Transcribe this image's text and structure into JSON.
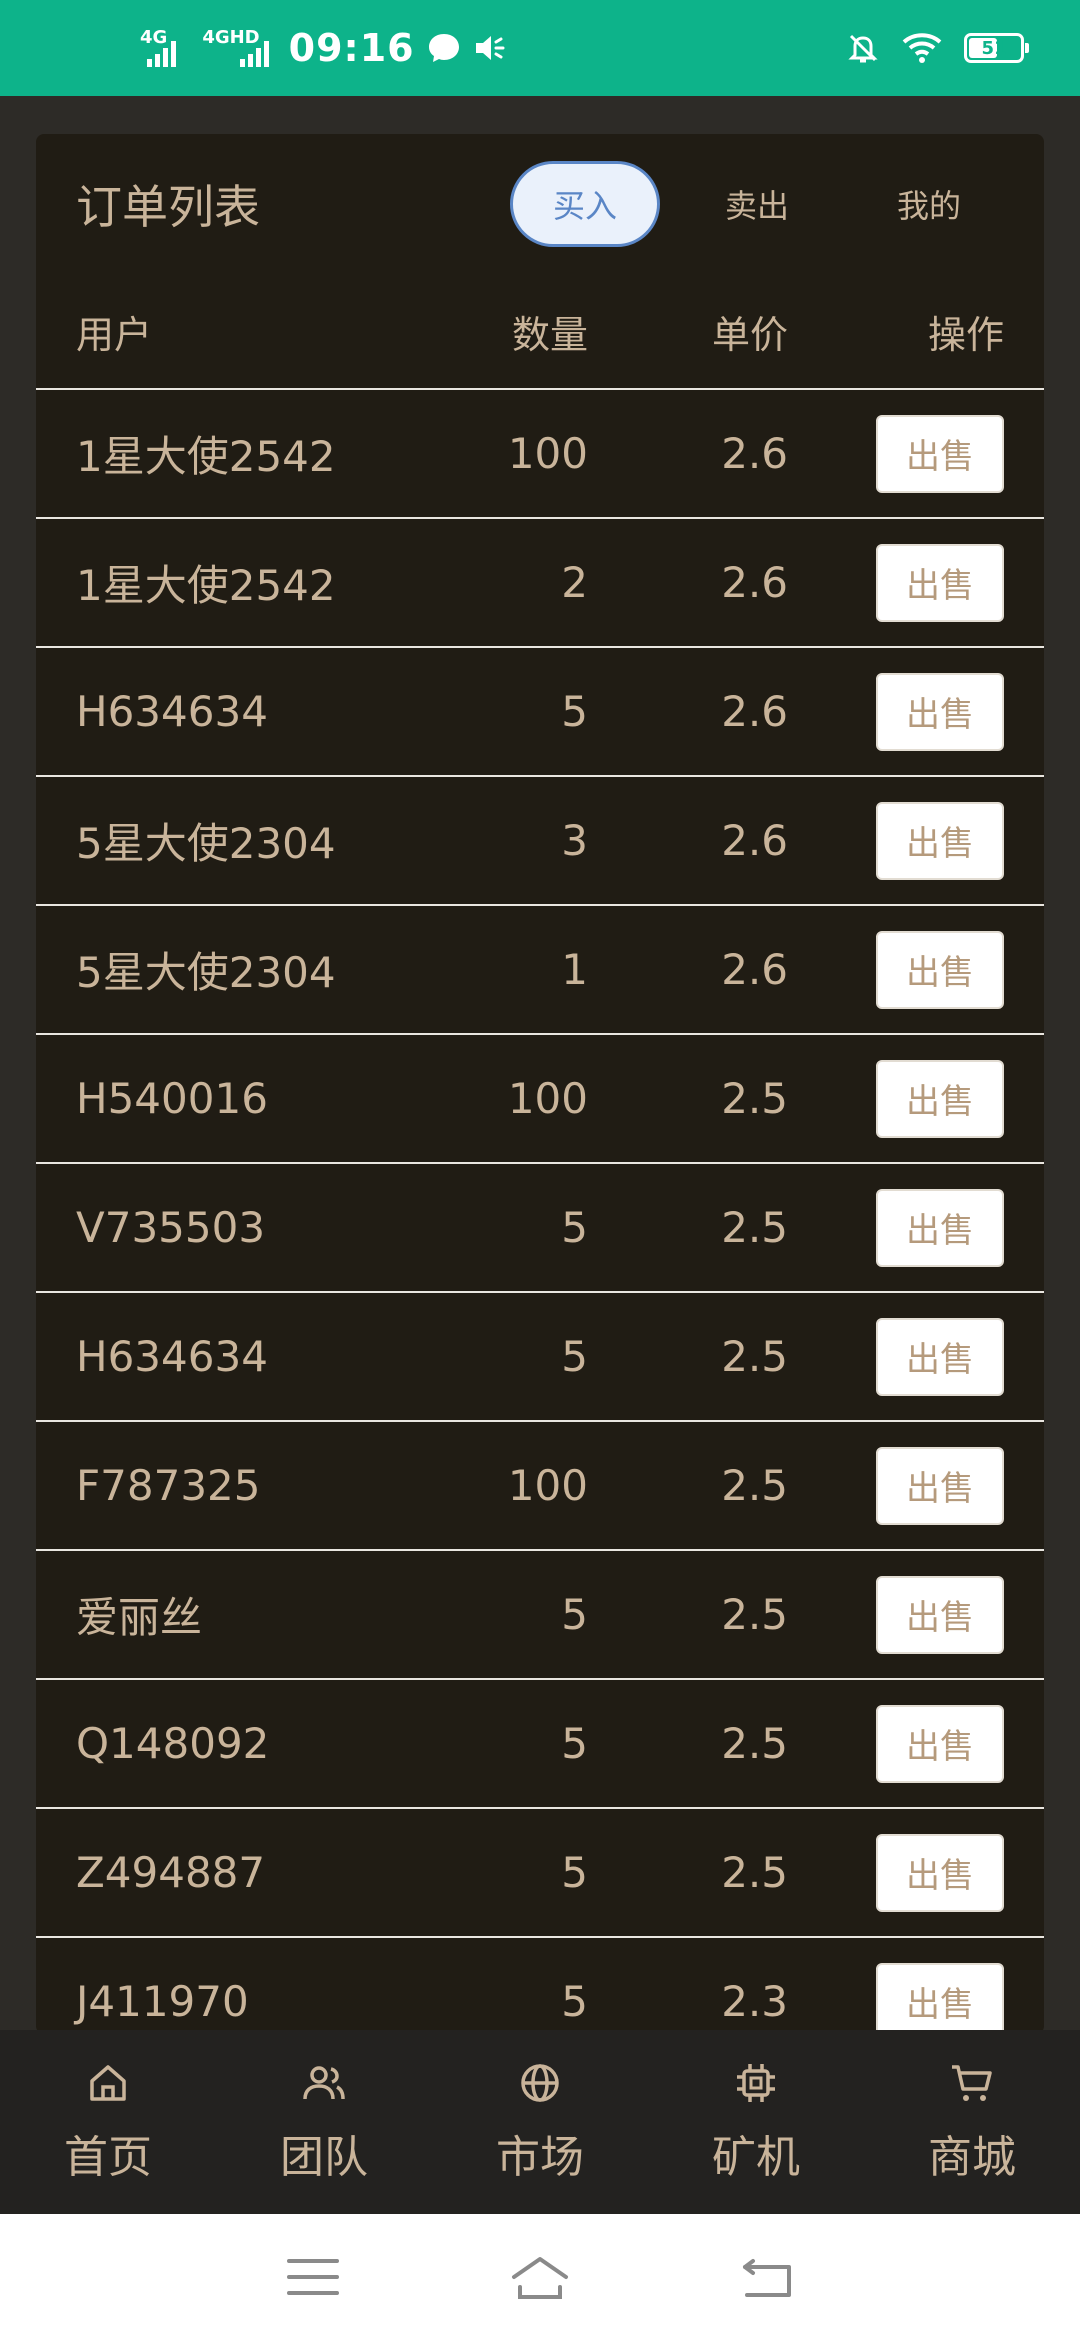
{
  "status_bar": {
    "net1": "4G",
    "net2": "4GHD",
    "time": "09:16",
    "battery": "51"
  },
  "header": {
    "title": "订单列表",
    "tabs": [
      {
        "label": "买入",
        "active": true
      },
      {
        "label": "卖出",
        "active": false
      },
      {
        "label": "我的",
        "active": false
      }
    ]
  },
  "table": {
    "columns": [
      "用户",
      "数量",
      "单价",
      "操作"
    ],
    "rows": [
      {
        "user": "1星大使2542",
        "qty": "100",
        "price": "2.6",
        "action": "出售"
      },
      {
        "user": "1星大使2542",
        "qty": "2",
        "price": "2.6",
        "action": "出售"
      },
      {
        "user": "H634634",
        "qty": "5",
        "price": "2.6",
        "action": "出售"
      },
      {
        "user": "5星大使2304",
        "qty": "3",
        "price": "2.6",
        "action": "出售"
      },
      {
        "user": "5星大使2304",
        "qty": "1",
        "price": "2.6",
        "action": "出售"
      },
      {
        "user": "H540016",
        "qty": "100",
        "price": "2.5",
        "action": "出售"
      },
      {
        "user": "V735503",
        "qty": "5",
        "price": "2.5",
        "action": "出售"
      },
      {
        "user": "H634634",
        "qty": "5",
        "price": "2.5",
        "action": "出售"
      },
      {
        "user": "F787325",
        "qty": "100",
        "price": "2.5",
        "action": "出售"
      },
      {
        "user": "爱丽丝",
        "qty": "5",
        "price": "2.5",
        "action": "出售"
      },
      {
        "user": "Q148092",
        "qty": "5",
        "price": "2.5",
        "action": "出售"
      },
      {
        "user": "Z494887",
        "qty": "5",
        "price": "2.5",
        "action": "出售"
      },
      {
        "user": "J411970",
        "qty": "5",
        "price": "2.3",
        "action": "出售"
      }
    ]
  },
  "bottom_nav": [
    {
      "label": "首页",
      "icon": "home-icon"
    },
    {
      "label": "团队",
      "icon": "team-icon"
    },
    {
      "label": "市场",
      "icon": "globe-icon"
    },
    {
      "label": "矿机",
      "icon": "chip-icon"
    },
    {
      "label": "商城",
      "icon": "cart-icon"
    }
  ],
  "colors": {
    "status_bar": "#0db38a",
    "card_bg": "#201c14",
    "text": "#c9b49a",
    "active_tab": "#5a86c6"
  }
}
